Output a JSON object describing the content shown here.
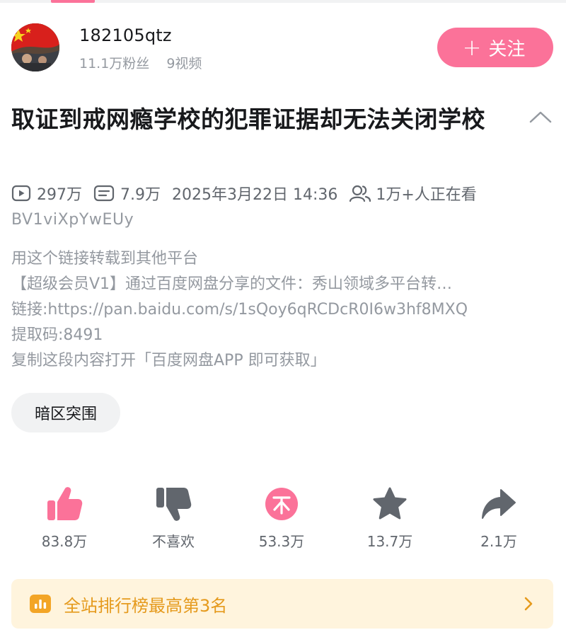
{
  "user": {
    "name": "182105qtz",
    "fans": "11.1万粉丝",
    "videos": "9视频",
    "follow_label": "关注"
  },
  "video": {
    "title": "取证到戒网瘾学校的犯罪证据却无法关闭学校",
    "views": "297万",
    "danmaku": "7.9万",
    "datetime": "2025年3月22日 14:36",
    "watching": "1万+人正在看",
    "bvid": "BV1viXpYwEUy"
  },
  "description": [
    "用这个链接转载到其他平台",
    "【超级会员V1】通过百度网盘分享的文件：秀山领域多平台转…",
    "链接:https://pan.baidu.com/s/1sQoy6qRCDcR0I6w3hf8MXQ",
    "提取码:8491",
    "复制这段内容打开「百度网盘APP 即可获取」"
  ],
  "tag": "暗区突围",
  "actions": {
    "like": "83.8万",
    "dislike": "不喜欢",
    "coin": "53.3万",
    "favorite": "13.7万",
    "share": "2.1万"
  },
  "rank_banner": "全站排行榜最高第3名",
  "colors": {
    "accent": "#fb7299",
    "secondary_text": "#9499a0",
    "icon_gray": "#61666d",
    "banner_bg": "#fff4dd",
    "banner_text": "#e59a1d"
  },
  "icons": {
    "views": "play-box-icon",
    "danmaku": "danmaku-icon",
    "watching": "people-icon",
    "like": "thumbs-up-icon",
    "dislike": "thumbs-down-icon",
    "coin": "coin-icon",
    "favorite": "star-icon",
    "share": "share-arrow-icon",
    "rank": "bar-chart-icon"
  }
}
